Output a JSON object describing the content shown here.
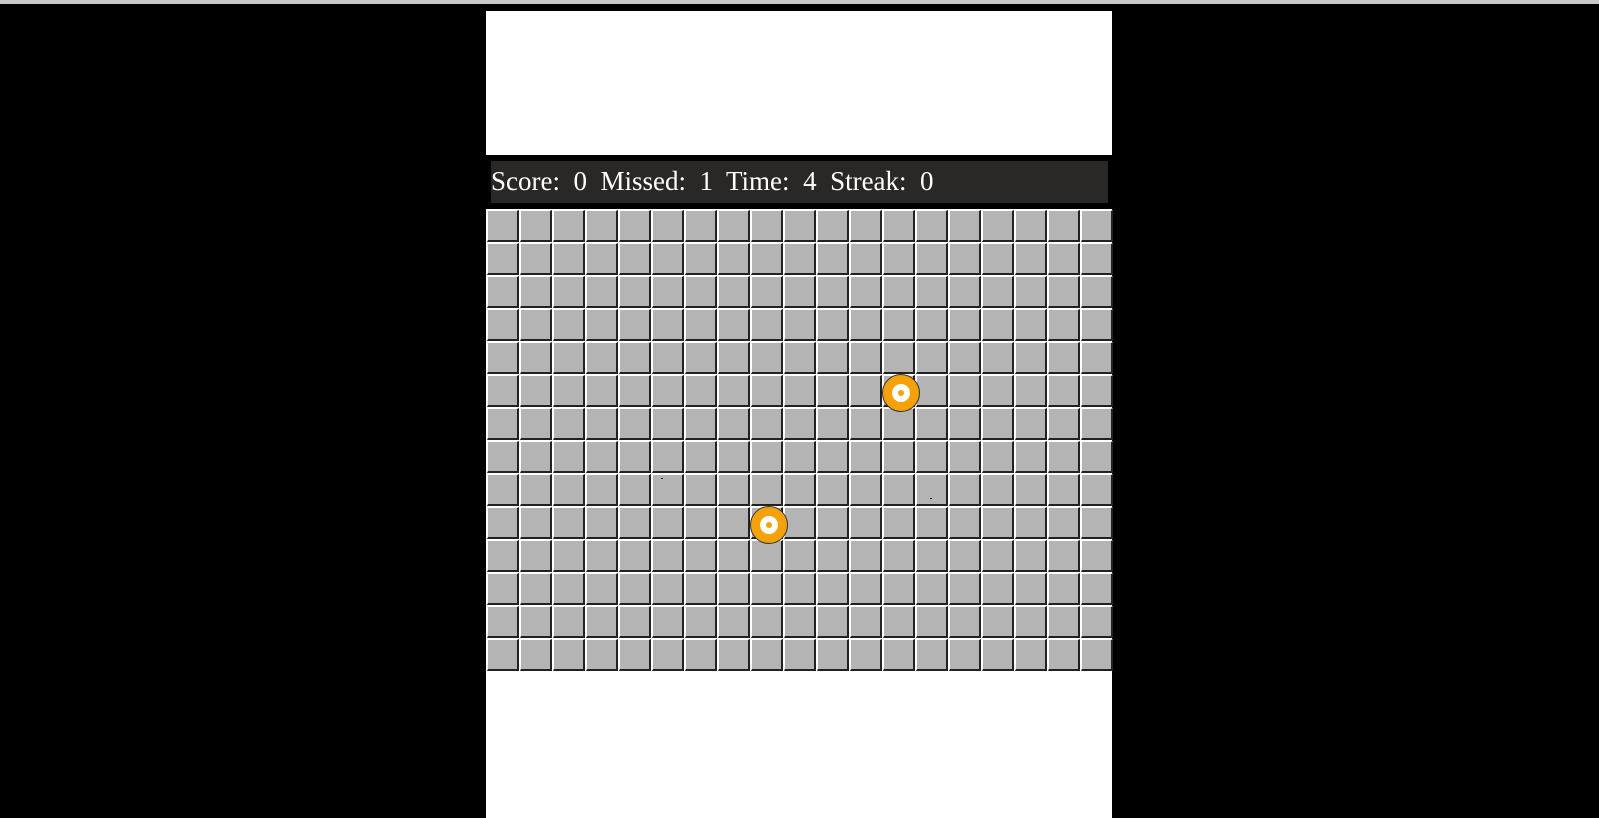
{
  "status": {
    "score_label": "Score:",
    "score": "0",
    "missed_label": "Missed:",
    "missed": "1",
    "time_label": "Time:",
    "time": "4",
    "streak_label": "Streak:",
    "streak": "0"
  },
  "grid": {
    "cols": 19,
    "rows": 14,
    "cell_color": "#b4b4b4"
  },
  "targets": [
    {
      "name": "target-1",
      "col": 12,
      "row": 5
    },
    {
      "name": "target-2",
      "col": 8,
      "row": 9
    }
  ],
  "colors": {
    "background": "#000000",
    "status_bar": "#2a2826",
    "target_outer": "#f5a20a",
    "target_inner": "#ffffff"
  }
}
